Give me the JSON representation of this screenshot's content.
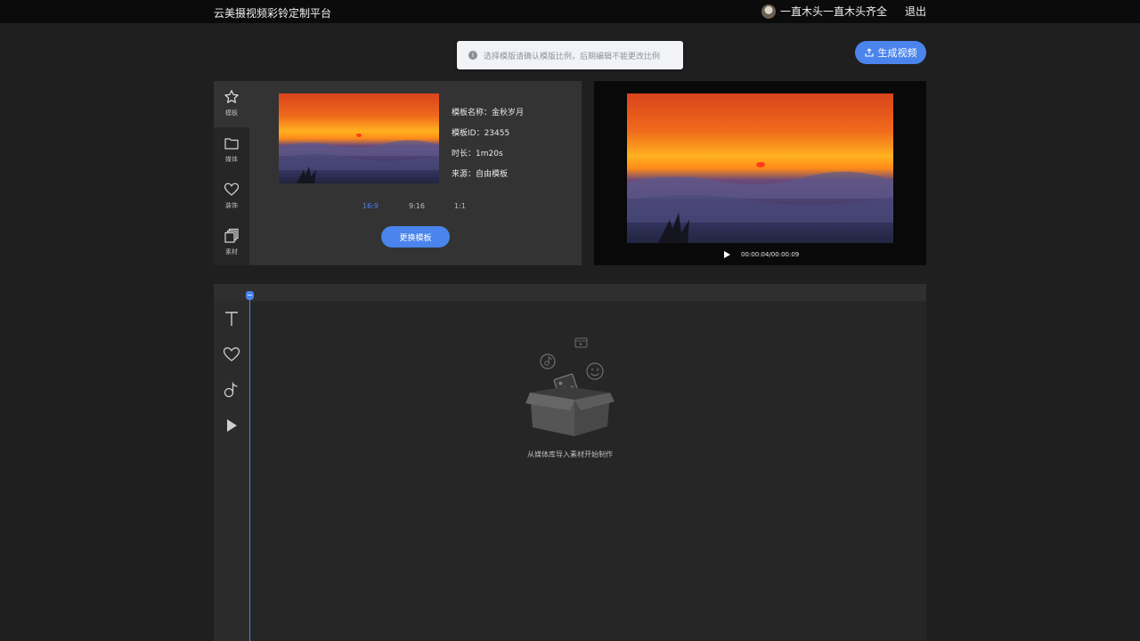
{
  "header": {
    "brand": "云美摄视频彩铃定制平台",
    "username": "一直木头一直木头齐全",
    "logout": "退出"
  },
  "notice": {
    "icon": "info-icon",
    "text": "选择模版请确认模版比例，后期编辑不能更改比例"
  },
  "toolbar": {
    "generate_label": "生成视频",
    "generate_icon": "upload-icon"
  },
  "side_tabs": [
    {
      "label": "模板",
      "icon": "star-icon",
      "active": true
    },
    {
      "label": "媒体",
      "icon": "folder-icon",
      "active": false
    },
    {
      "label": "装饰",
      "icon": "heart-icon",
      "active": false
    },
    {
      "label": "素材",
      "icon": "layers-icon",
      "active": false
    }
  ],
  "template": {
    "name_line": "模板名称：金秋岁月",
    "id_line": "模板ID：23455",
    "duration_line": "时长：1m20s",
    "source_line": "来源：自由模板",
    "ratios": [
      "16:9",
      "9:16",
      "1:1"
    ],
    "selected_ratio": "16:9",
    "swap_label": "更换模板"
  },
  "preview": {
    "time": "00:00:04/00:00:09"
  },
  "timeline": {
    "tools": [
      "text-icon",
      "heart-icon",
      "music-icon",
      "video-icon"
    ],
    "empty_text": "从媒体库导入素材开始制作"
  },
  "colors": {
    "accent": "#4a84ec",
    "background": "#1f1f1f"
  }
}
